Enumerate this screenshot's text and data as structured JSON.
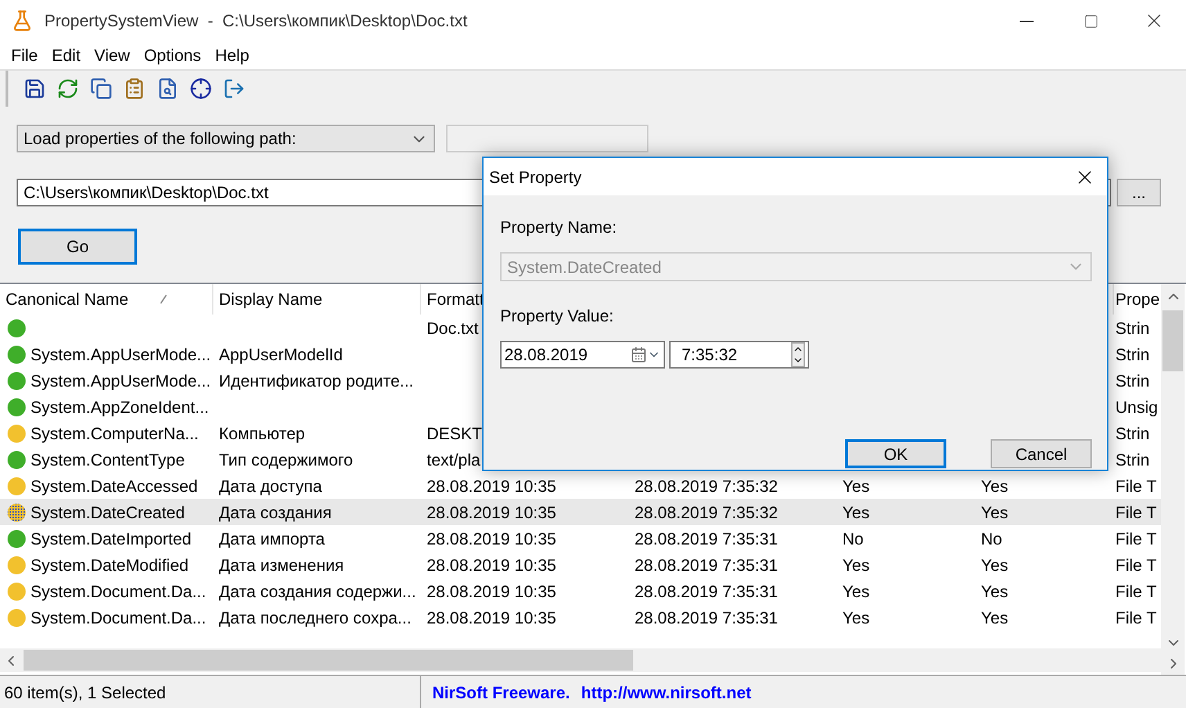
{
  "window": {
    "title": "PropertySystemView  -  C:\\Users\\компик\\Desktop\\Doc.txt"
  },
  "menu": [
    "File",
    "Edit",
    "View",
    "Options",
    "Help"
  ],
  "source": {
    "mode": "Load properties of the following path:",
    "path": "C:\\Users\\компик\\Desktop\\Doc.txt",
    "browse": "...",
    "go": "Go"
  },
  "table": {
    "columns": [
      {
        "label": "Canonical Name",
        "sorted": true
      },
      {
        "label": "Display Name"
      },
      {
        "label": "Formatt"
      },
      null,
      null,
      null,
      {
        "label": "Prope"
      }
    ],
    "rows": [
      {
        "color": "#3fae2a",
        "selected": false,
        "cells": [
          null,
          null,
          "Doc.txt",
          null,
          null,
          null,
          "Strin"
        ]
      },
      {
        "color": "#3fae2a",
        "selected": false,
        "cells": [
          "System.AppUserMode...",
          "AppUserModelId",
          null,
          null,
          null,
          null,
          "Strin"
        ]
      },
      {
        "color": "#3fae2a",
        "selected": false,
        "cells": [
          "System.AppUserMode...",
          "Идентификатор родите...",
          null,
          null,
          null,
          null,
          "Strin"
        ]
      },
      {
        "color": "#3fae2a",
        "selected": false,
        "cells": [
          "System.AppZoneIdent...",
          null,
          null,
          null,
          null,
          null,
          "Unsig"
        ]
      },
      {
        "color": "#f2c12e",
        "selected": false,
        "cells": [
          "System.ComputerNa...",
          "Компьютер",
          "DESKT",
          null,
          null,
          null,
          "Strin"
        ]
      },
      {
        "color": "#3fae2a",
        "selected": false,
        "cells": [
          "System.ContentType",
          "Тип содержимого",
          "text/pla",
          null,
          null,
          null,
          "Strin"
        ]
      },
      {
        "color": "#f2c12e",
        "selected": false,
        "cells": [
          "System.DateAccessed",
          "Дата доступа",
          "28.08.2019 10:35",
          "28.08.2019 7:35:32",
          "Yes",
          "Yes",
          "File T"
        ]
      },
      {
        "color": "#f2c12e",
        "selected": true,
        "cells": [
          "System.DateCreated",
          "Дата создания",
          "28.08.2019 10:35",
          "28.08.2019 7:35:32",
          "Yes",
          "Yes",
          "File T"
        ]
      },
      {
        "color": "#3fae2a",
        "selected": false,
        "cells": [
          "System.DateImported",
          "Дата импорта",
          "28.08.2019 10:35",
          "28.08.2019 7:35:31",
          "No",
          "No",
          "File T"
        ]
      },
      {
        "color": "#f2c12e",
        "selected": false,
        "cells": [
          "System.DateModified",
          "Дата изменения",
          "28.08.2019 10:35",
          "28.08.2019 7:35:31",
          "Yes",
          "Yes",
          "File T"
        ]
      },
      {
        "color": "#f2c12e",
        "selected": false,
        "cells": [
          "System.Document.Da...",
          "Дата создания содержи...",
          "28.08.2019 10:35",
          "28.08.2019 7:35:31",
          "Yes",
          "Yes",
          "File T"
        ]
      },
      {
        "color": "#f2c12e",
        "selected": false,
        "cells": [
          "System.Document.Da...",
          "Дата последнего сохра...",
          "28.08.2019 10:35",
          "28.08.2019 7:35:31",
          "Yes",
          "Yes",
          "File T"
        ]
      }
    ]
  },
  "dialog": {
    "title": "Set Property",
    "name_label": "Property Name:",
    "name_value": "System.DateCreated",
    "name_disabled": true,
    "value_label": "Property Value:",
    "date": "28.08.2019",
    "time": "7:35:32",
    "ok": "OK",
    "cancel": "Cancel"
  },
  "status": {
    "count": "60 item(s), 1 Selected",
    "credit": "NirSoft Freeware.",
    "link": "http://www.nirsoft.net"
  }
}
